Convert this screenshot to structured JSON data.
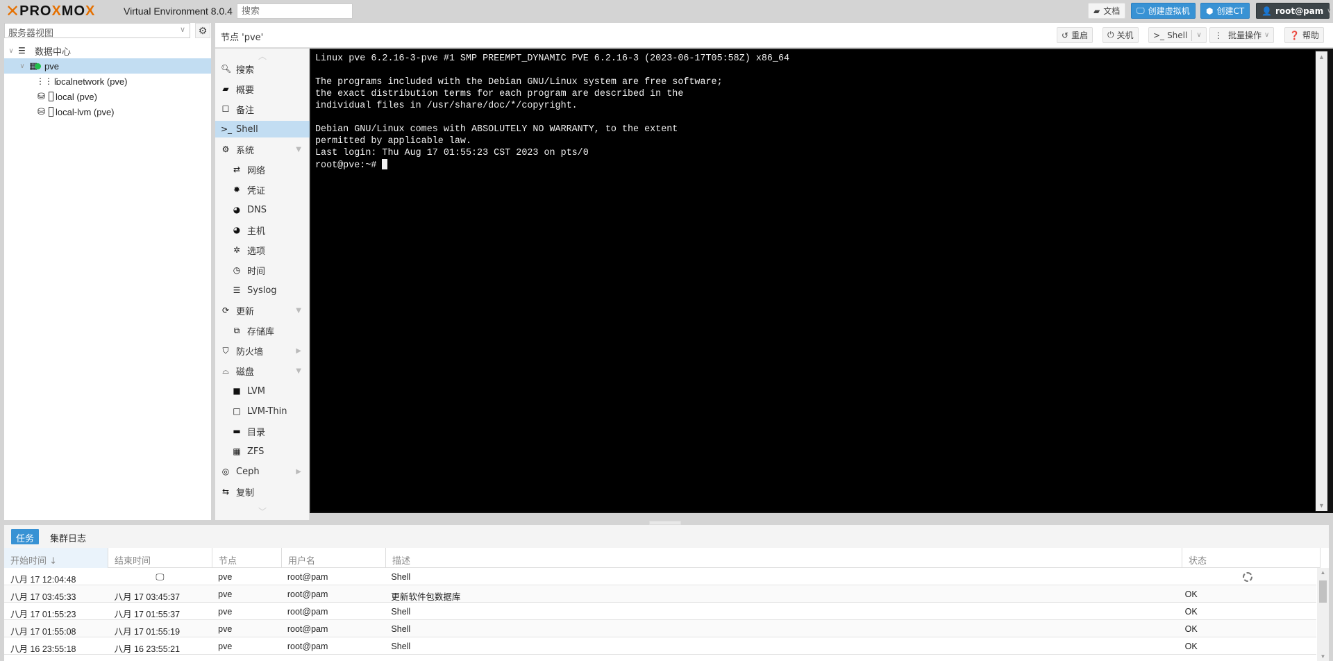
{
  "header": {
    "brand": "PROXMOX",
    "product": "Virtual Environment 8.0.4",
    "search_placeholder": "搜索",
    "buttons": {
      "docs": "文档",
      "create_vm": "创建虚拟机",
      "create_ct": "创建CT",
      "user": "root@pam"
    }
  },
  "sidebar": {
    "view_selector": "服务器视图",
    "tree": [
      {
        "label": "数据中心",
        "icon": "datacenter-icon",
        "level": 0,
        "expanded": true
      },
      {
        "label": "pve",
        "icon": "node-online-icon",
        "level": 1,
        "expanded": true,
        "selected": true
      },
      {
        "label": "localnetwork (pve)",
        "icon": "sdn-zone-icon",
        "level": 2
      },
      {
        "label": "local (pve)",
        "icon": "storage-icon",
        "level": 2
      },
      {
        "label": "local-lvm (pve)",
        "icon": "storage-icon",
        "level": 2
      }
    ]
  },
  "node": {
    "title": "节点 'pve'",
    "actions": {
      "reboot": "重启",
      "shutdown": "关机",
      "shell": "Shell",
      "bulk": "批量操作",
      "help": "帮助"
    }
  },
  "menu": {
    "items": [
      {
        "label": "搜索",
        "icon": "search-icon",
        "sub": false
      },
      {
        "label": "概要",
        "icon": "book-icon",
        "sub": false
      },
      {
        "label": "备注",
        "icon": "note-icon",
        "sub": false
      },
      {
        "label": "Shell",
        "icon": "terminal-icon",
        "sub": false,
        "selected": true
      },
      {
        "label": "系统",
        "icon": "cogs-icon",
        "sub": false,
        "expand": "down"
      },
      {
        "label": "网络",
        "icon": "exchange-icon",
        "sub": true
      },
      {
        "label": "凭证",
        "icon": "certificate-icon",
        "sub": true
      },
      {
        "label": "DNS",
        "icon": "globe-icon",
        "sub": true
      },
      {
        "label": "主机",
        "icon": "globe-icon",
        "sub": true
      },
      {
        "label": "选项",
        "icon": "gear-icon",
        "sub": true
      },
      {
        "label": "时间",
        "icon": "clock-icon",
        "sub": true
      },
      {
        "label": "Syslog",
        "icon": "list-icon",
        "sub": true
      },
      {
        "label": "更新",
        "icon": "refresh-icon",
        "sub": false,
        "expand": "down"
      },
      {
        "label": "存储库",
        "icon": "files-icon",
        "sub": true
      },
      {
        "label": "防火墙",
        "icon": "shield-icon",
        "sub": false,
        "expand": "right"
      },
      {
        "label": "磁盘",
        "icon": "hdd-icon",
        "sub": false,
        "expand": "down"
      },
      {
        "label": "LVM",
        "icon": "square-filled-icon",
        "sub": true
      },
      {
        "label": "LVM-Thin",
        "icon": "square-outline-icon",
        "sub": true
      },
      {
        "label": "目录",
        "icon": "folder-icon",
        "sub": true
      },
      {
        "label": "ZFS",
        "icon": "grid-icon",
        "sub": true
      },
      {
        "label": "Ceph",
        "icon": "ceph-icon",
        "sub": false,
        "expand": "right"
      },
      {
        "label": "复制",
        "icon": "retweet-icon",
        "sub": false
      }
    ]
  },
  "terminal": {
    "lines": [
      "Linux pve 6.2.16-3-pve #1 SMP PREEMPT_DYNAMIC PVE 6.2.16-3 (2023-06-17T05:58Z) x86_64",
      "",
      "The programs included with the Debian GNU/Linux system are free software;",
      "the exact distribution terms for each program are described in the",
      "individual files in /usr/share/doc/*/copyright.",
      "",
      "Debian GNU/Linux comes with ABSOLUTELY NO WARRANTY, to the extent",
      "permitted by applicable law.",
      "Last login: Thu Aug 17 01:55:23 CST 2023 on pts/0"
    ],
    "prompt": "root@pve:~# "
  },
  "bottom": {
    "tabs": [
      "任务",
      "集群日志"
    ],
    "active_tab": "任务",
    "columns": [
      "开始时间 ↓",
      "结束时间",
      "节点",
      "用户名",
      "描述",
      "状态"
    ],
    "rows": [
      {
        "start": "八月 17 12:04:48",
        "end": "",
        "end_icon": "console-icon",
        "node": "pve",
        "user": "root@pam",
        "desc": "Shell",
        "status": "",
        "status_icon": "loading-spinner-icon"
      },
      {
        "start": "八月 17 03:45:33",
        "end": "八月 17 03:45:37",
        "node": "pve",
        "user": "root@pam",
        "desc": "更新软件包数据库",
        "status": "OK"
      },
      {
        "start": "八月 17 01:55:23",
        "end": "八月 17 01:55:37",
        "node": "pve",
        "user": "root@pam",
        "desc": "Shell",
        "status": "OK"
      },
      {
        "start": "八月 17 01:55:08",
        "end": "八月 17 01:55:19",
        "node": "pve",
        "user": "root@pam",
        "desc": "Shell",
        "status": "OK"
      },
      {
        "start": "八月 16 23:55:18",
        "end": "八月 16 23:55:21",
        "node": "pve",
        "user": "root@pam",
        "desc": "Shell",
        "status": "OK"
      }
    ]
  },
  "colors": {
    "accent": "#3892d4",
    "brand_orange": "#e57000",
    "selection": "#c2ddf2",
    "user_button": "#3d4549"
  }
}
